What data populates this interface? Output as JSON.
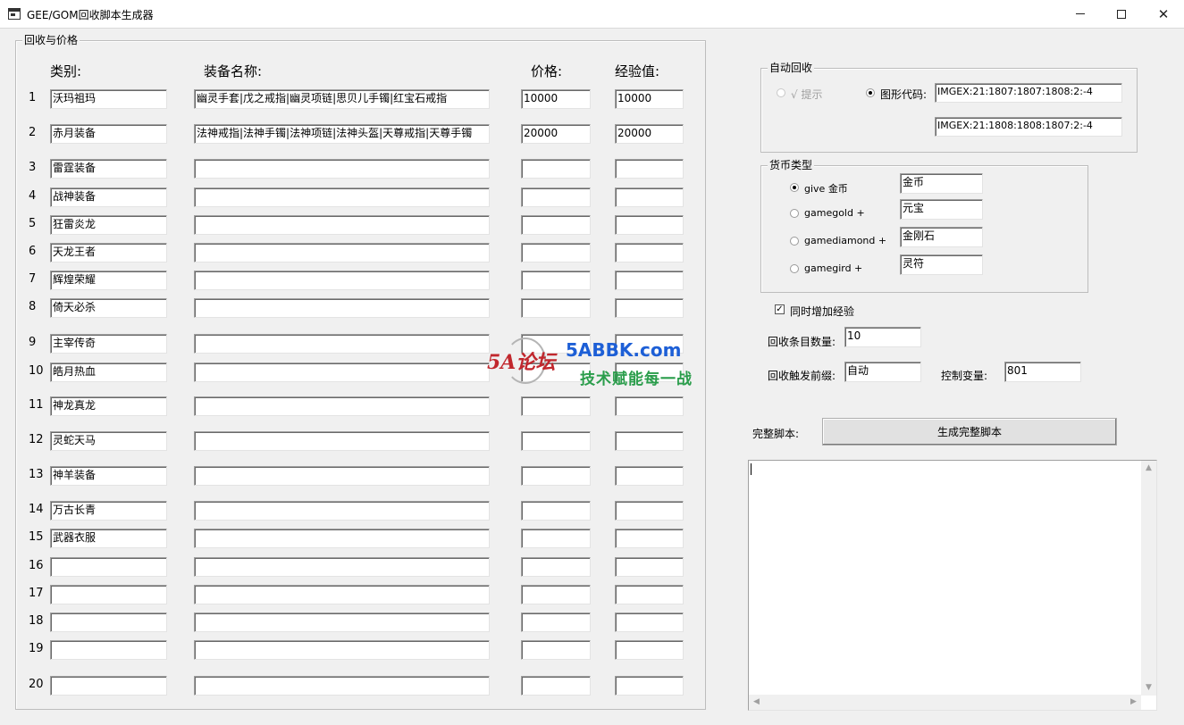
{
  "window": {
    "title": "GEE/GOM回收脚本生成器"
  },
  "left_group": {
    "title": "回收与价格",
    "headers": {
      "category": "类别:",
      "items": "装备名称:",
      "price": "价格:",
      "exp": "经验值:"
    },
    "rows": [
      {
        "num": "1",
        "category": "沃玛祖玛",
        "items": "幽灵手套|戊之戒指|幽灵项链|思贝儿手镯|红宝石戒指",
        "price": "10000",
        "exp": "10000"
      },
      {
        "num": "2",
        "category": "赤月装备",
        "items": "法神戒指|法神手镯|法神项链|法神头盔|天尊戒指|天尊手镯",
        "price": "20000",
        "exp": "20000"
      },
      {
        "num": "3",
        "category": "雷霆装备",
        "items": "",
        "price": "",
        "exp": ""
      },
      {
        "num": "4",
        "category": "战神装备",
        "items": "",
        "price": "",
        "exp": ""
      },
      {
        "num": "5",
        "category": "狂雷炎龙",
        "items": "",
        "price": "",
        "exp": ""
      },
      {
        "num": "6",
        "category": "天龙王者",
        "items": "",
        "price": "",
        "exp": ""
      },
      {
        "num": "7",
        "category": "辉煌荣耀",
        "items": "",
        "price": "",
        "exp": ""
      },
      {
        "num": "8",
        "category": "倚天必杀",
        "items": "",
        "price": "",
        "exp": ""
      },
      {
        "num": "9",
        "category": "主宰传奇",
        "items": "",
        "price": "",
        "exp": ""
      },
      {
        "num": "10",
        "category": "皓月热血",
        "items": "",
        "price": "",
        "exp": ""
      },
      {
        "num": "11",
        "category": "神龙真龙",
        "items": "",
        "price": "",
        "exp": ""
      },
      {
        "num": "12",
        "category": "灵蛇天马",
        "items": "",
        "price": "",
        "exp": ""
      },
      {
        "num": "13",
        "category": "神羊装备",
        "items": "",
        "price": "",
        "exp": ""
      },
      {
        "num": "14",
        "category": "万古长青",
        "items": "",
        "price": "",
        "exp": ""
      },
      {
        "num": "15",
        "category": "武器衣服",
        "items": "",
        "price": "",
        "exp": ""
      },
      {
        "num": "16",
        "category": "",
        "items": "",
        "price": "",
        "exp": ""
      },
      {
        "num": "17",
        "category": "",
        "items": "",
        "price": "",
        "exp": ""
      },
      {
        "num": "18",
        "category": "",
        "items": "",
        "price": "",
        "exp": ""
      },
      {
        "num": "19",
        "category": "",
        "items": "",
        "price": "",
        "exp": ""
      },
      {
        "num": "20",
        "category": "",
        "items": "",
        "price": "",
        "exp": ""
      }
    ]
  },
  "auto_recycle": {
    "title": "自动回收",
    "hint_label": "√ 提示",
    "graphic_label": "图形代码:",
    "code1": "IMGEX:21:1807:1807:1808:2:-4",
    "code2": "IMGEX:21:1808:1808:1807:2:-4"
  },
  "currency": {
    "title": "货币类型",
    "options": [
      {
        "label": "give 金币",
        "value": "金币",
        "checked": true
      },
      {
        "label": "gamegold +",
        "value": "元宝",
        "checked": false
      },
      {
        "label": "gamediamond +",
        "value": "金刚石",
        "checked": false
      },
      {
        "label": "gamegird +",
        "value": "灵符",
        "checked": false
      }
    ]
  },
  "options": {
    "add_exp_label": "同时增加经验",
    "add_exp_checked": true,
    "count_label": "回收条目数量:",
    "count_value": "10",
    "prefix_label": "回收触发前缀:",
    "prefix_value": "自动",
    "var_label": "控制变量:",
    "var_value": "801"
  },
  "script": {
    "label": "完整脚本:",
    "button_label": "生成完整脚本",
    "content": ""
  },
  "watermark": {
    "brand": "5A论坛",
    "site": "5ABBK.com",
    "slogan": "技术赋能每一战"
  }
}
